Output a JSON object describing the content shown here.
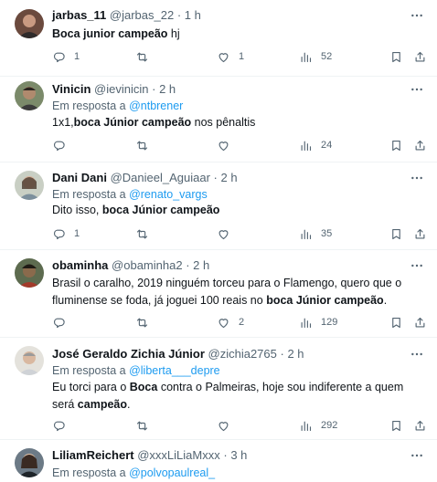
{
  "tweets": [
    {
      "name": "jarbas_11",
      "handle": "@jarbas_22",
      "dot": "·",
      "time": "1 h",
      "reply_prefix": "",
      "reply_mention": "",
      "text_parts": [
        {
          "t": "Boca junior campeão",
          "b": true
        },
        {
          "t": " hj",
          "b": false
        }
      ],
      "replies": "1",
      "retweets": "",
      "likes": "1",
      "views": "52"
    },
    {
      "name": "Vinicin",
      "handle": "@ievinicin",
      "dot": "·",
      "time": "2 h",
      "reply_prefix": "Em resposta a ",
      "reply_mention": "@ntbrener",
      "text_parts": [
        {
          "t": "1x1,",
          "b": false
        },
        {
          "t": "boca Júnior campeão",
          "b": true
        },
        {
          "t": " nos pênaltis",
          "b": false
        }
      ],
      "replies": "",
      "retweets": "",
      "likes": "",
      "views": "24"
    },
    {
      "name": "Dani Dani",
      "handle": "@Danieel_Aguiaar",
      "dot": "·",
      "time": "2 h",
      "reply_prefix": "Em resposta a ",
      "reply_mention": "@renato_vargs",
      "text_parts": [
        {
          "t": "Dito isso, ",
          "b": false
        },
        {
          "t": "boca Júnior campeão",
          "b": true
        }
      ],
      "replies": "1",
      "retweets": "",
      "likes": "",
      "views": "35"
    },
    {
      "name": "obaminha",
      "handle": "@obaminha2",
      "dot": "·",
      "time": "2 h",
      "reply_prefix": "",
      "reply_mention": "",
      "text_parts": [
        {
          "t": "Brasil o caralho,  2019 ninguém torceu para o Flamengo,  quero que o fluminense se foda,  já joguei 100 reais no ",
          "b": false
        },
        {
          "t": "boca Júnior campeão",
          "b": true
        },
        {
          "t": ".",
          "b": false
        }
      ],
      "replies": "",
      "retweets": "",
      "likes": "2",
      "views": "129"
    },
    {
      "name": "José Geraldo Zichia Júnior",
      "handle": "@zichia2765",
      "dot": "·",
      "time": "2 h",
      "reply_prefix": "Em resposta a ",
      "reply_mention": "@liberta___depre",
      "text_parts": [
        {
          "t": "Eu torci para o ",
          "b": false
        },
        {
          "t": "Boca",
          "b": true
        },
        {
          "t": " contra o Palmeiras, hoje sou indiferente a quem será ",
          "b": false
        },
        {
          "t": "campeão",
          "b": true
        },
        {
          "t": ".",
          "b": false
        }
      ],
      "replies": "",
      "retweets": "",
      "likes": "",
      "views": "292"
    },
    {
      "name": "LiliamReichert",
      "handle": "@xxxLiLiaMxxx",
      "dot": "·",
      "time": "3 h",
      "reply_prefix": "Em resposta a ",
      "reply_mention": "@polvopaulreal_",
      "text_parts": [],
      "replies": "",
      "retweets": "",
      "likes": "",
      "views": ""
    }
  ],
  "colors": {
    "text": "#0f1419",
    "secondary": "#536471",
    "link": "#1d9bf0",
    "divider": "#eff3f4"
  },
  "icons": {
    "reply": "reply-icon",
    "retweet": "retweet-icon",
    "like": "heart-icon",
    "views": "views-chart-icon",
    "bookmark": "bookmark-icon",
    "share": "share-icon",
    "more": "more-options-icon"
  }
}
